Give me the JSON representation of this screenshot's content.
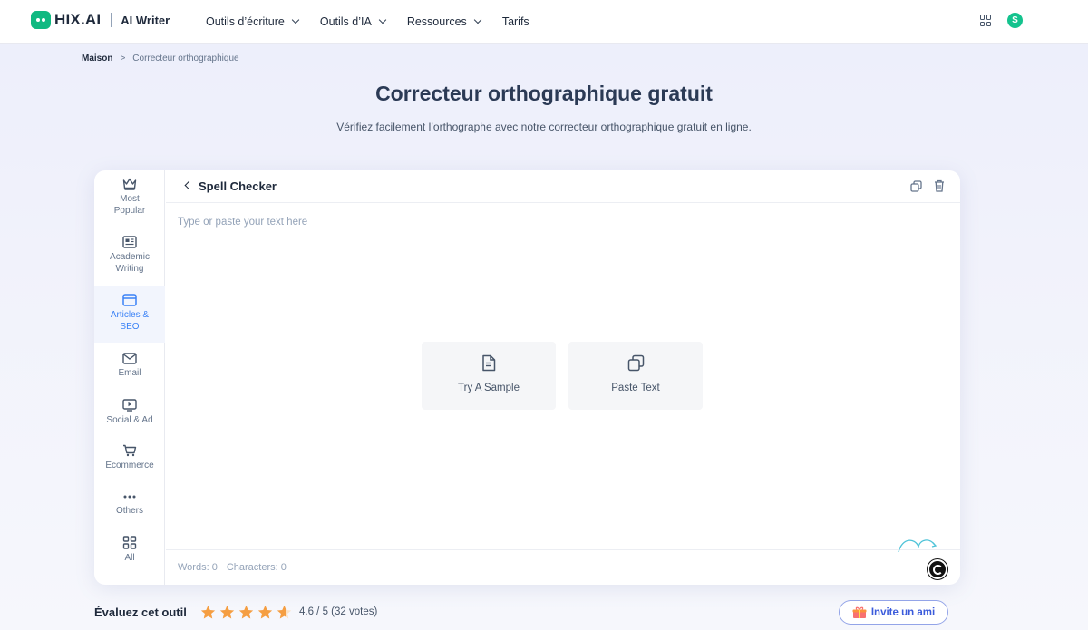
{
  "header": {
    "brand": "HIX.AI",
    "product": "AI Writer",
    "nav": [
      {
        "label": "Outils d’écriture",
        "has_caret": true
      },
      {
        "label": "Outils d’IA",
        "has_caret": true
      },
      {
        "label": "Ressources",
        "has_caret": true
      },
      {
        "label": "Tarifs",
        "has_caret": false
      }
    ],
    "avatar_initial": "S",
    "accent": "#14c38e"
  },
  "breadcrumb": {
    "home": "Maison",
    "separator": ">",
    "current": "Correcteur orthographique"
  },
  "page": {
    "title": "Correcteur orthographique gratuit",
    "subtitle": "Vérifiez facilement l’orthographe avec notre correcteur orthographique gratuit en ligne."
  },
  "sidebar": {
    "items": [
      {
        "label": "Most\nPopular",
        "icon": "crown-icon",
        "active": false
      },
      {
        "label": "Academic\nWriting",
        "icon": "newspaper-icon",
        "active": false
      },
      {
        "label": "Articles &\nSEO",
        "icon": "browser-icon",
        "active": true
      },
      {
        "label": "Email",
        "icon": "mail-icon",
        "active": false
      },
      {
        "label": "Social & Ad",
        "icon": "monitor-play-icon",
        "active": false
      },
      {
        "label": "Ecommerce",
        "icon": "cart-icon",
        "active": false
      },
      {
        "label": "Others",
        "icon": "dots-icon",
        "active": false
      },
      {
        "label": "All",
        "icon": "grid-icon",
        "active": false
      }
    ]
  },
  "editor": {
    "title": "Spell Checker",
    "placeholder": "Type or paste your text here",
    "try_sample": "Try A Sample",
    "paste_text": "Paste Text",
    "words": "Words: 0",
    "characters": "Characters: 0"
  },
  "rating": {
    "label": "Évaluez cet outil",
    "value": "4.6 / 5 (32 votes)",
    "stars": 4.6,
    "star_color": "#f59e42"
  },
  "invite": {
    "label": "Invite un ami"
  }
}
